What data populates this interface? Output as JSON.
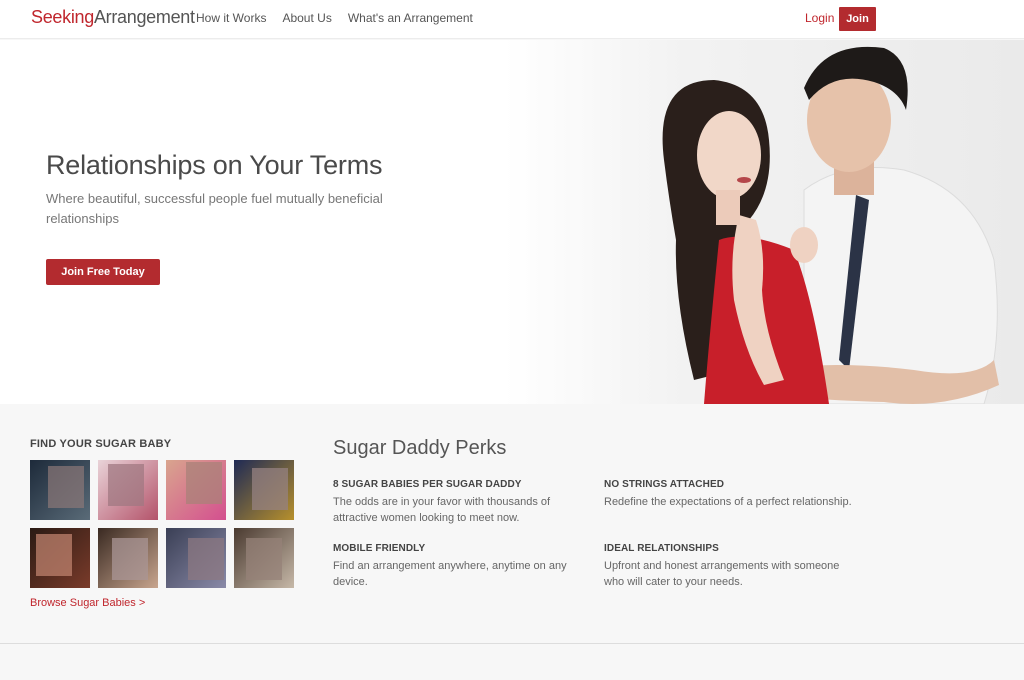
{
  "header": {
    "logo_part1": "Seeking",
    "logo_part2": "Arrangement",
    "nav": [
      "How it Works",
      "About Us",
      "What's an Arrangement"
    ],
    "login": "Login",
    "join": "Join"
  },
  "hero": {
    "title": "Relationships on Your Terms",
    "subtitle": "Where beautiful, successful people fuel mutually beneficial relationships",
    "cta": "Join Free Today"
  },
  "find": {
    "title": "FIND YOUR SUGAR BABY",
    "browse": "Browse Sugar Babies >"
  },
  "perks": {
    "title": "Sugar Daddy Perks",
    "items": [
      {
        "heading": "8 SUGAR BABIES PER SUGAR DADDY",
        "text": "The odds are in your favor with thousands of attractive women looking to meet now."
      },
      {
        "heading": "NO STRINGS ATTACHED",
        "text": "Redefine the expectations of a perfect relationship."
      },
      {
        "heading": "MOBILE FRIENDLY",
        "text": "Find an arrangement anywhere, anytime on any device."
      },
      {
        "heading": "IDEAL RELATIONSHIPS",
        "text": "Upfront and honest arrangements with someone who will cater to your needs."
      }
    ]
  },
  "colors": {
    "brand_red": "#b32b2f",
    "link_red": "#c0262d"
  }
}
